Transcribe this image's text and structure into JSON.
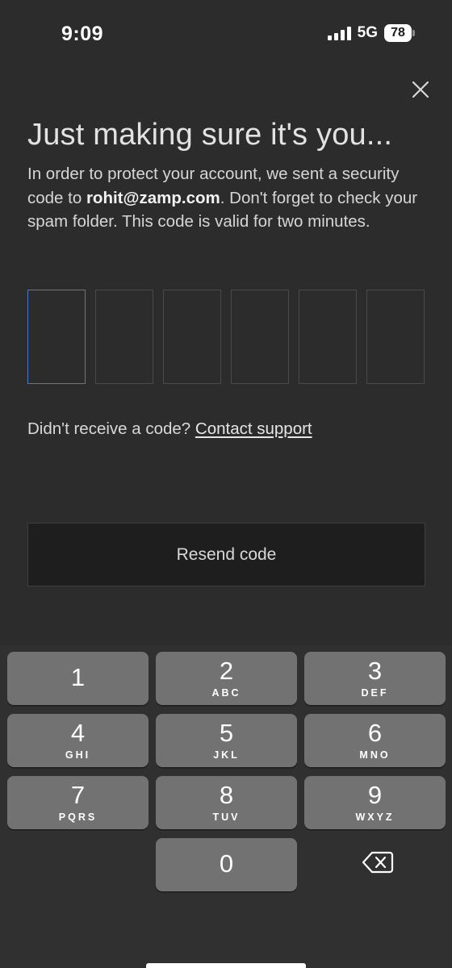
{
  "status_bar": {
    "time": "9:09",
    "network": "5G",
    "battery": "78"
  },
  "dialog": {
    "title": "Just making sure it's you...",
    "desc_before": "In order to protect your account, we sent a security code to ",
    "email": "rohit@zamp.com",
    "desc_after": ". Don't forget to check your spam folder. This code is valid for two minutes.",
    "code_length": 6,
    "code_values": [
      "",
      "",
      "",
      "",
      "",
      ""
    ],
    "support_prompt": "Didn't receive a code?",
    "support_link": "Contact support",
    "resend_label": "Resend code",
    "colors": {
      "background": "#2c2c2c",
      "active_box_border": "#4f78c4",
      "button_background": "#1e1e1e"
    }
  },
  "keyboard": {
    "keys": [
      {
        "digit": "1",
        "letters": ""
      },
      {
        "digit": "2",
        "letters": "ABC"
      },
      {
        "digit": "3",
        "letters": "DEF"
      },
      {
        "digit": "4",
        "letters": "GHI"
      },
      {
        "digit": "5",
        "letters": "JKL"
      },
      {
        "digit": "6",
        "letters": "MNO"
      },
      {
        "digit": "7",
        "letters": "PQRS"
      },
      {
        "digit": "8",
        "letters": "TUV"
      },
      {
        "digit": "9",
        "letters": "WXYZ"
      },
      {
        "digit": "0",
        "letters": ""
      }
    ],
    "backspace_icon": "backspace-icon"
  }
}
